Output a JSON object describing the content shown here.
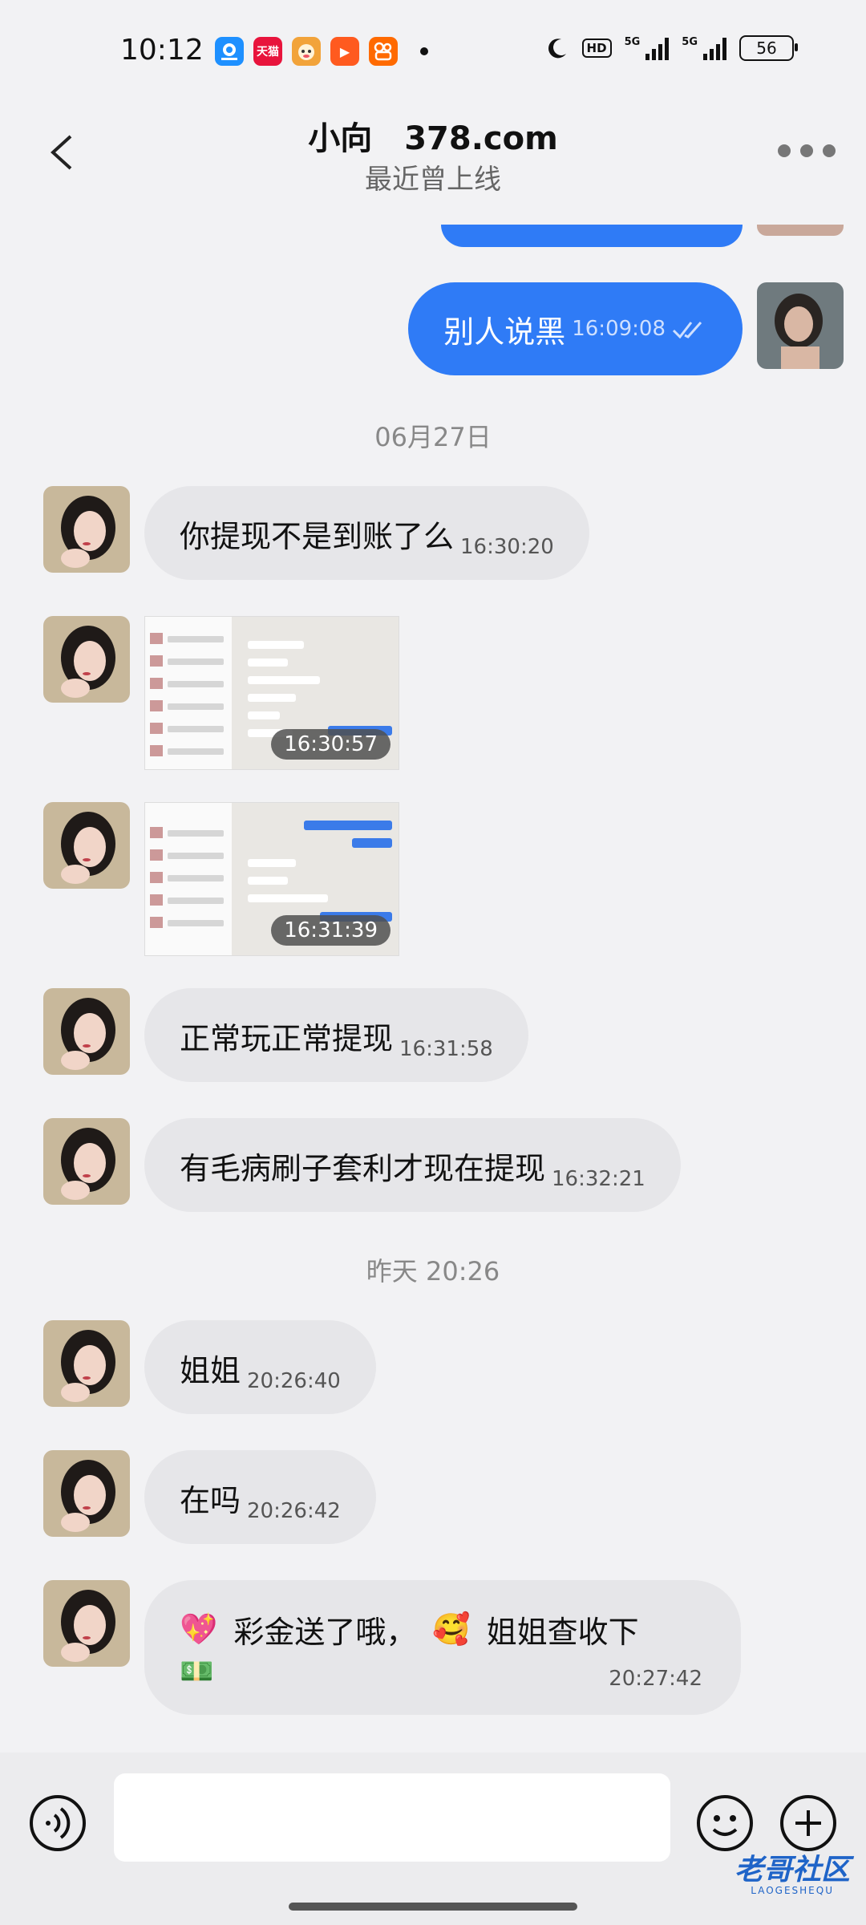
{
  "status_bar": {
    "time": "10:12",
    "apps": [
      {
        "name": "qq-browser-icon",
        "glyph": "",
        "color": "#1e90ff"
      },
      {
        "name": "tmall-icon",
        "glyph": "天猫",
        "color": "#e8143c"
      },
      {
        "name": "cartoon-app-icon",
        "glyph": "",
        "color": "#f2a33a"
      },
      {
        "name": "video-app-icon",
        "glyph": "▶",
        "color": "#ff5a1f"
      },
      {
        "name": "kuaishou-icon",
        "glyph": "",
        "color": "#ff6a00"
      }
    ],
    "hd_label": "HD",
    "network_1": "5G",
    "network_2": "5G",
    "battery": "56"
  },
  "header": {
    "title": "小向　378.com",
    "subtitle": "最近曾上线"
  },
  "messages": [
    {
      "type": "out",
      "text": "别人说黑",
      "time": "16:09:08"
    },
    {
      "type": "date",
      "text": "06月27日"
    },
    {
      "type": "in",
      "text": "你提现不是到账了么",
      "time": "16:30:20"
    },
    {
      "type": "in-image",
      "time": "16:30:57"
    },
    {
      "type": "in-image",
      "time": "16:31:39"
    },
    {
      "type": "in",
      "text": "正常玩正常提现",
      "time": "16:31:58"
    },
    {
      "type": "in",
      "text": "有毛病刷子套利才现在提现",
      "time": "16:32:21"
    },
    {
      "type": "date",
      "text": "昨天 20:26"
    },
    {
      "type": "in",
      "text": "姐姐",
      "time": "20:26:40"
    },
    {
      "type": "in",
      "text": "在吗",
      "time": "20:26:42"
    },
    {
      "type": "in-emoji",
      "emoji_1": "💖",
      "text_1": "彩金送了哦，",
      "emoji_2": "🥰",
      "text_2": "姐姐查收下",
      "emoji_3": "💵",
      "time": "20:27:42"
    }
  ],
  "watermark": {
    "text": "老哥社区",
    "sub": "LAOGESHEQU"
  },
  "colors": {
    "outgoing_bubble": "#2f7bf6",
    "incoming_bubble": "#e6e6e9",
    "background": "#f2f2f4"
  }
}
